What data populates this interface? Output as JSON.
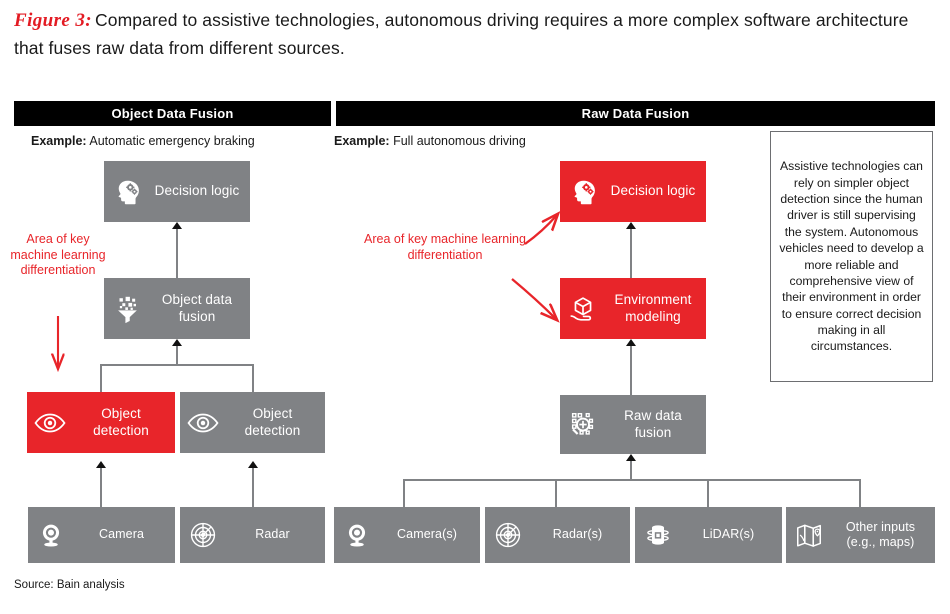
{
  "figure": {
    "label": "Figure 3:",
    "caption": "Compared to assistive technologies, autonomous driving requires a more complex software architecture that fuses raw data from different sources."
  },
  "headers": {
    "left": "Object Data Fusion",
    "right": "Raw Data Fusion"
  },
  "examples": {
    "left_label": "Example:",
    "left_value": "Automatic emergency braking",
    "right_label": "Example:",
    "right_value": "Full autonomous driving"
  },
  "annotations": {
    "left": "Area of key machine learning differentiation",
    "right": "Area of key machine learning differentiation"
  },
  "sidenote": "Assistive technologies can rely on simpler object detection since the human driver is still supervising the system. Autonomous vehicles need to develop a more reliable and comprehensive view of their environment in order to ensure correct decision making in all circumstances.",
  "source": "Source: Bain analysis",
  "colors": {
    "accent_red": "#e8252a",
    "node_grey": "#808285",
    "header_black": "#000000",
    "connector_grey": "#808285"
  },
  "left_column": {
    "decision_logic": {
      "label": "Decision logic",
      "icon": "head-gears-icon",
      "color": "grey"
    },
    "object_data_fusion": {
      "label": "Object data fusion",
      "icon": "funnel-icon",
      "color": "grey"
    },
    "object_detection_1": {
      "label": "Object detection",
      "icon": "eye-icon",
      "color": "red"
    },
    "object_detection_2": {
      "label": "Object detection",
      "icon": "eye-icon",
      "color": "grey"
    },
    "sensors": [
      {
        "label": "Camera",
        "icon": "camera-icon"
      },
      {
        "label": "Radar",
        "icon": "radar-icon"
      }
    ]
  },
  "right_column": {
    "decision_logic": {
      "label": "Decision logic",
      "icon": "head-gears-icon",
      "color": "red"
    },
    "environment_modeling": {
      "label": "Environment modeling",
      "icon": "cube-hand-icon",
      "color": "red"
    },
    "raw_data_fusion": {
      "label": "Raw data fusion",
      "icon": "data-merge-icon",
      "color": "grey"
    },
    "sensors": [
      {
        "label": "Camera(s)",
        "icon": "camera-icon"
      },
      {
        "label": "Radar(s)",
        "icon": "radar-icon"
      },
      {
        "label": "LiDAR(s)",
        "icon": "lidar-icon"
      },
      {
        "label": "Other inputs (e.g., maps)",
        "icon": "map-icon"
      }
    ]
  }
}
